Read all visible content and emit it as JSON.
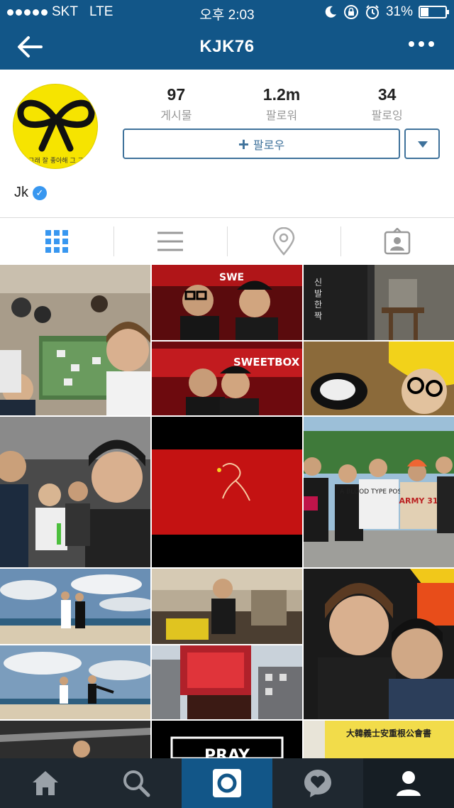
{
  "status_bar": {
    "carrier": "SKT",
    "network": "LTE",
    "time": "오후 2:03",
    "battery": "31%",
    "battery_level": 0.31
  },
  "nav": {
    "title": "KJK76",
    "back_icon": "back-arrow-icon",
    "more_icon": "more-dots-icon"
  },
  "profile": {
    "avatar_text": "그래 잘 좋아해 그 그",
    "posts_count": "97",
    "posts_label": "게시물",
    "followers_count": "1.2m",
    "followers_label": "팔로워",
    "following_count": "34",
    "following_label": "팔로잉",
    "follow_label": "팔로우",
    "name": "Jk"
  },
  "tabs": [
    {
      "name": "grid-view-icon",
      "active": true
    },
    {
      "name": "list-view-icon",
      "active": false
    },
    {
      "name": "location-icon",
      "active": false
    },
    {
      "name": "tagged-photos-icon",
      "active": false
    }
  ],
  "photo_text": {
    "sweetbox": "SWEETBOX",
    "sign_chars": "신 발 한 짝",
    "army_text": "ARMY 31",
    "blood_text": "A BLOOD TYPE POSITIVE",
    "pray_text": "PRAY",
    "dosa_text": "大韓義士安重根公會書"
  },
  "bottom_nav": [
    {
      "name": "home-icon",
      "active": false
    },
    {
      "name": "search-icon",
      "active": false
    },
    {
      "name": "camera-icon",
      "active": true
    },
    {
      "name": "activity-icon",
      "active": false
    },
    {
      "name": "profile-icon",
      "active": false
    }
  ],
  "colors": {
    "brand_blue": "#125688",
    "button_blue": "#3f729b",
    "tab_active": "#3897f0",
    "bottom_bar": "#1f2830"
  }
}
